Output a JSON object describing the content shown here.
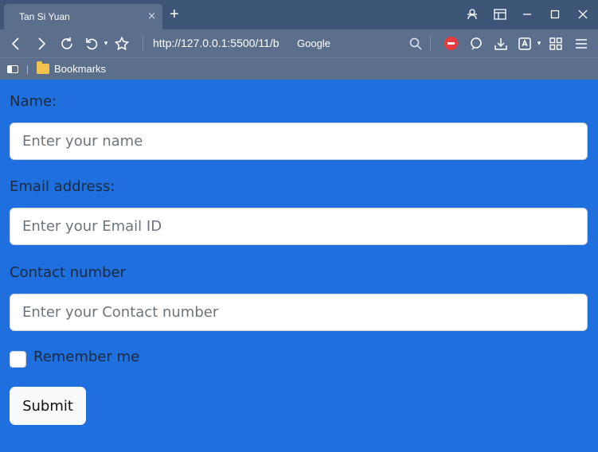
{
  "browser": {
    "tab_title": "Tan Si Yuan",
    "tab_close": "×",
    "new_tab": "+",
    "url": "http://127.0.0.1:5500/11/b",
    "search_engine": "Google",
    "bookmarks_label": "Bookmarks"
  },
  "form": {
    "name_label": "Name:",
    "name_placeholder": "Enter your name",
    "email_label": "Email address:",
    "email_placeholder": "Enter your Email ID",
    "contact_label": "Contact number",
    "contact_placeholder": "Enter your Contact number",
    "remember_label": "Remember me",
    "submit_label": "Submit"
  },
  "colors": {
    "page_background": "#1f6fde",
    "browser_chrome": "#5b6f8c",
    "titlebar": "#3d5577"
  }
}
